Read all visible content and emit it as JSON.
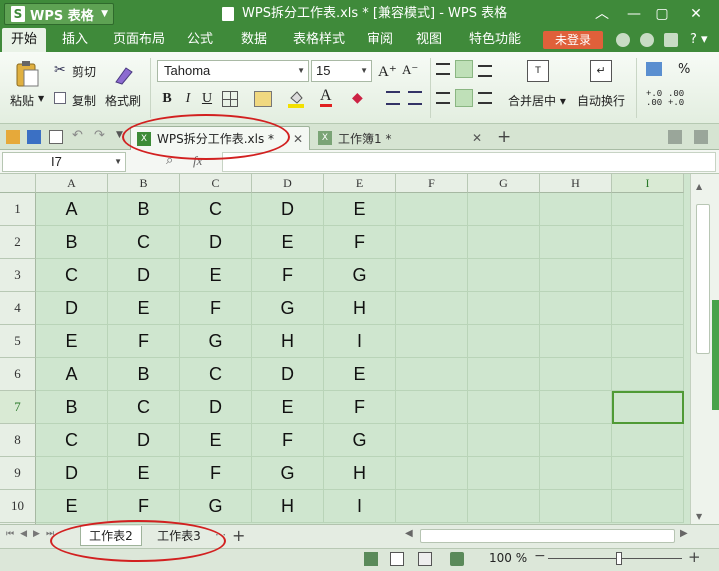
{
  "app": {
    "logo_label": "WPS 表格",
    "window_title": "WPS拆分工作表.xls * [兼容模式] - WPS 表格"
  },
  "menu": {
    "items": [
      "开始",
      "插入",
      "页面布局",
      "公式",
      "数据",
      "表格样式",
      "审阅",
      "视图",
      "特色功能"
    ],
    "active_index": 0,
    "login_label": "未登录",
    "help_label": "?"
  },
  "ribbon": {
    "paste_label": "粘贴",
    "cut_label": "剪切",
    "copy_label": "复制",
    "format_painter_label": "格式刷",
    "font_name": "Tahoma",
    "font_size": "15",
    "bold_label": "B",
    "italic_label": "I",
    "underline_label": "U",
    "merge_label": "合并居中",
    "wrap_label": "自动换行",
    "percent_label": "%",
    "increase_decimal_label": "+.0\n.00",
    "decrease_decimal_label": ".00\n+.0",
    "grow_font_label": "A⁺",
    "shrink_font_label": "A⁻"
  },
  "doc_tabs": [
    {
      "label": "WPS拆分工作表.xls *",
      "active": true
    },
    {
      "label": "工作簿1 *",
      "active": false
    }
  ],
  "formula": {
    "cell_ref": "I7",
    "fx_label": "fx",
    "value": ""
  },
  "sheet": {
    "columns": [
      "A",
      "B",
      "C",
      "D",
      "E",
      "F",
      "G",
      "H",
      "I"
    ],
    "rows": [
      {
        "num": "1",
        "cells": [
          "A",
          "B",
          "C",
          "D",
          "E"
        ]
      },
      {
        "num": "2",
        "cells": [
          "B",
          "C",
          "D",
          "E",
          "F"
        ]
      },
      {
        "num": "3",
        "cells": [
          "C",
          "D",
          "E",
          "F",
          "G"
        ]
      },
      {
        "num": "4",
        "cells": [
          "D",
          "E",
          "F",
          "G",
          "H"
        ]
      },
      {
        "num": "5",
        "cells": [
          "E",
          "F",
          "G",
          "H",
          "I"
        ]
      },
      {
        "num": "6",
        "cells": [
          "A",
          "B",
          "C",
          "D",
          "E"
        ]
      },
      {
        "num": "7",
        "cells": [
          "B",
          "C",
          "D",
          "E",
          "F"
        ]
      },
      {
        "num": "8",
        "cells": [
          "C",
          "D",
          "E",
          "F",
          "G"
        ]
      },
      {
        "num": "9",
        "cells": [
          "D",
          "E",
          "F",
          "G",
          "H"
        ]
      },
      {
        "num": "10",
        "cells": [
          "E",
          "F",
          "G",
          "H",
          "I"
        ]
      }
    ],
    "active_cell": "I7",
    "fill_color": "#cfe6cf",
    "select_color": "#4f9a35"
  },
  "sheet_tabs": [
    {
      "label": "工作表2",
      "active": true
    },
    {
      "label": "工作表3",
      "active": false
    }
  ],
  "status": {
    "zoom": "100 %",
    "zoom_fraction": 0.5
  },
  "annotations_color": "#d22020"
}
